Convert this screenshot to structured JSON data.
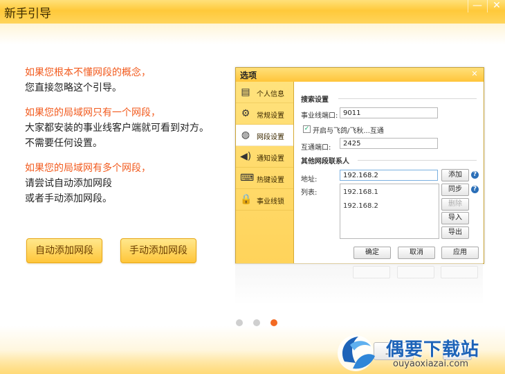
{
  "window": {
    "title": "新手引导",
    "minimize_glyph": "—",
    "close_glyph": "✕"
  },
  "guide": {
    "lines": [
      {
        "text": "如果您根本不懂网段的概念，",
        "color": "orange"
      },
      {
        "text": "您直接忽略这个引导。",
        "color": "dark"
      },
      {
        "text": "如果您的局域网只有一个网段，",
        "color": "orange"
      },
      {
        "text": "大家都安装的事业线客户端就可看到对方。",
        "color": "dark"
      },
      {
        "text": "不需要任何设置。",
        "color": "dark"
      },
      {
        "text": "如果您的局域网有多个网段，",
        "color": "orange"
      },
      {
        "text": "请尝试自动添加网段",
        "color": "dark"
      },
      {
        "text": "或者手动添加网段。",
        "color": "dark"
      }
    ]
  },
  "buttons": {
    "auto_add": "自动添加网段",
    "manual_add": "手动添加网段"
  },
  "dialog": {
    "title": "选项",
    "close_glyph": "✕",
    "sidebar": [
      {
        "label": "个人信息",
        "icon": "id-card-icon",
        "glyph": "▤"
      },
      {
        "label": "常规设置",
        "icon": "gear-icon",
        "glyph": "⚙"
      },
      {
        "label": "网段设置",
        "icon": "globe-icon",
        "glyph": "◍"
      },
      {
        "label": "通知设置",
        "icon": "speaker-icon",
        "glyph": "◀)"
      },
      {
        "label": "热键设置",
        "icon": "keyboard-icon",
        "glyph": "⌨"
      },
      {
        "label": "事业线锁",
        "icon": "lock-icon",
        "glyph": "🔒"
      }
    ],
    "active_index": 2,
    "search_section": "搜索设置",
    "port_label": "事业线端口:",
    "port_value": "9011",
    "interop_checkbox_label": "开启与飞鸽/飞秋...互通",
    "interop_checked": true,
    "interop_port_label": "互通端口:",
    "interop_port_value": "2425",
    "contacts_section": "其他网段联系人",
    "address_label": "地址:",
    "address_value": "192.168.2",
    "list_label": "列表:",
    "list_items": [
      "192.168.1",
      "192.168.2"
    ],
    "side_buttons": {
      "add": "添加",
      "sync": "同步",
      "delete": "删除",
      "import": "导入",
      "export": "导出"
    },
    "help_glyph": "?",
    "footer": {
      "ok": "确定",
      "cancel": "取消",
      "apply": "应用"
    }
  },
  "pagination": {
    "total": 3,
    "active": 3
  },
  "overlay_button": "上一",
  "watermark": {
    "text": "偶要下载站",
    "url": "ouyaoxiazai.com"
  },
  "colors": {
    "accent_orange": "#f25a1d",
    "title_yellow": "#ffc93a",
    "watermark_blue": "#1d63b8"
  }
}
